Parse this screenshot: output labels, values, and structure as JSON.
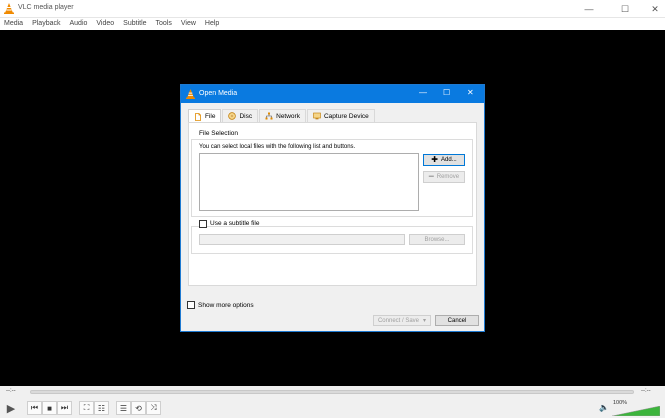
{
  "window": {
    "title": "VLC media player",
    "controls": {
      "minimize": "—",
      "maximize": "☐",
      "close": "✕"
    }
  },
  "menu": [
    "Media",
    "Playback",
    "Audio",
    "Video",
    "Subtitle",
    "Tools",
    "View",
    "Help"
  ],
  "dialog": {
    "title": "Open Media",
    "controls": {
      "minimize": "—",
      "maximize": "☐",
      "close": "✕"
    },
    "tabs": [
      {
        "label": "File",
        "icon": "file-icon",
        "active": true
      },
      {
        "label": "Disc",
        "icon": "disc-icon",
        "active": false
      },
      {
        "label": "Network",
        "icon": "network-icon",
        "active": false
      },
      {
        "label": "Capture Device",
        "icon": "capture-device-icon",
        "active": false
      }
    ],
    "file_selection": {
      "group_label": "File Selection",
      "description": "You can select local files with the following list and buttons.",
      "add_label": "Add...",
      "remove_label": "Remove"
    },
    "subtitle": {
      "checkbox_label": "Use a subtitle file",
      "browse_label": "Browse..."
    },
    "show_more_label": "Show more options",
    "connect_label": "Connect / Save",
    "cancel_label": "Cancel"
  },
  "controls": {
    "time_elapsed": "--:--",
    "time_total": "--:--",
    "volume": "100%"
  },
  "colors": {
    "accent": "#0a7ae0",
    "vlc_orange": "#f08a00",
    "volume_green": "#3cb43c"
  }
}
